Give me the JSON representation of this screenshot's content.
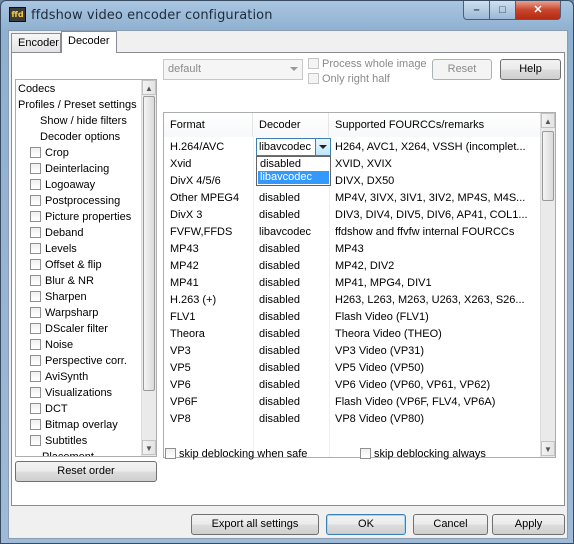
{
  "window": {
    "title": "ffdshow video encoder configuration",
    "icon": "ffdshow-app-icon",
    "icon_text": "ffd"
  },
  "caption_buttons": {
    "minimize": "–",
    "maximize": "□",
    "close": "✕"
  },
  "tabs": [
    {
      "label": "Encoder",
      "active": false
    },
    {
      "label": "Decoder",
      "active": true
    }
  ],
  "tree": {
    "items": [
      {
        "label": "Codecs",
        "indent": 0,
        "checkbox": false
      },
      {
        "label": "Profiles / Preset settings",
        "indent": 0,
        "checkbox": false
      },
      {
        "label": "Show / hide filters",
        "indent": 2,
        "checkbox": false
      },
      {
        "label": "Decoder options",
        "indent": 2,
        "checkbox": false
      },
      {
        "label": "Crop",
        "indent": 1,
        "checkbox": true
      },
      {
        "label": "Deinterlacing",
        "indent": 1,
        "checkbox": true
      },
      {
        "label": "Logoaway",
        "indent": 1,
        "checkbox": true
      },
      {
        "label": "Postprocessing",
        "indent": 1,
        "checkbox": true
      },
      {
        "label": "Picture properties",
        "indent": 1,
        "checkbox": true
      },
      {
        "label": "Deband",
        "indent": 1,
        "checkbox": true
      },
      {
        "label": "Levels",
        "indent": 1,
        "checkbox": true
      },
      {
        "label": "Offset & flip",
        "indent": 1,
        "checkbox": true
      },
      {
        "label": "Blur & NR",
        "indent": 1,
        "checkbox": true
      },
      {
        "label": "Sharpen",
        "indent": 1,
        "checkbox": true
      },
      {
        "label": "Warpsharp",
        "indent": 1,
        "checkbox": true
      },
      {
        "label": "DScaler filter",
        "indent": 1,
        "checkbox": true
      },
      {
        "label": "Noise",
        "indent": 1,
        "checkbox": true
      },
      {
        "label": "Perspective corr.",
        "indent": 1,
        "checkbox": true
      },
      {
        "label": "AviSynth",
        "indent": 1,
        "checkbox": true
      },
      {
        "label": "Visualizations",
        "indent": 1,
        "checkbox": true
      },
      {
        "label": "DCT",
        "indent": 1,
        "checkbox": true
      },
      {
        "label": "Bitmap overlay",
        "indent": 1,
        "checkbox": true
      },
      {
        "label": "Subtitles",
        "indent": 1,
        "checkbox": true
      },
      {
        "label": "Placement",
        "indent": 3,
        "checkbox": false
      }
    ]
  },
  "reset_order_label": "Reset order",
  "preset_combo": {
    "value": "default"
  },
  "process_whole_image": {
    "label": "Process whole image",
    "checked": false,
    "enabled": false
  },
  "only_right_half": {
    "label": "Only right half",
    "checked": false,
    "enabled": false
  },
  "reset_button": {
    "label": "Reset",
    "enabled": false
  },
  "help_button": {
    "label": "Help"
  },
  "grid": {
    "columns": [
      "Format",
      "Decoder",
      "Supported FOURCCs/remarks"
    ],
    "rows": [
      {
        "format": "H.264/AVC",
        "decoder": "libavcodec",
        "remarks": "H264, AVC1, X264, VSSH (incomplet..."
      },
      {
        "format": "Xvid",
        "decoder": "disabled",
        "remarks": "XVID, XVIX"
      },
      {
        "format": "DivX 4/5/6",
        "decoder": "disabled",
        "remarks": "DIVX, DX50"
      },
      {
        "format": "Other MPEG4",
        "decoder": "disabled",
        "remarks": "MP4V, 3IVX, 3IV1, 3IV2, MP4S, M4S..."
      },
      {
        "format": "DivX 3",
        "decoder": "disabled",
        "remarks": "DIV3, DIV4, DIV5, DIV6, AP41, COL1..."
      },
      {
        "format": "FVFW,FFDS",
        "decoder": "libavcodec",
        "remarks": "ffdshow and ffvfw internal FOURCCs"
      },
      {
        "format": "MP43",
        "decoder": "disabled",
        "remarks": "MP43"
      },
      {
        "format": "MP42",
        "decoder": "disabled",
        "remarks": "MP42, DIV2"
      },
      {
        "format": "MP41",
        "decoder": "disabled",
        "remarks": "MP41, MPG4, DIV1"
      },
      {
        "format": "H.263 (+)",
        "decoder": "disabled",
        "remarks": "H263, L263, M263, U263, X263, S26..."
      },
      {
        "format": "FLV1",
        "decoder": "disabled",
        "remarks": "Flash Video (FLV1)"
      },
      {
        "format": "Theora",
        "decoder": "disabled",
        "remarks": "Theora Video (THEO)"
      },
      {
        "format": "VP3",
        "decoder": "disabled",
        "remarks": "VP3 Video (VP31)"
      },
      {
        "format": "VP5",
        "decoder": "disabled",
        "remarks": "VP5 Video (VP50)"
      },
      {
        "format": "VP6",
        "decoder": "disabled",
        "remarks": "VP6 Video (VP60, VP61, VP62)"
      },
      {
        "format": "VP6F",
        "decoder": "disabled",
        "remarks": "Flash Video (VP6F, FLV4, VP6A)"
      },
      {
        "format": "VP8",
        "decoder": "disabled",
        "remarks": "VP8 Video (VP80)"
      }
    ],
    "open_dropdown": {
      "row": 0,
      "value": "libavcodec",
      "options": [
        "disabled",
        "libavcodec"
      ],
      "highlighted": "libavcodec"
    }
  },
  "skip_deblocking_safe": {
    "label": "skip deblocking when safe",
    "checked": false
  },
  "skip_deblocking_always": {
    "label": "skip deblocking always",
    "checked": false
  },
  "footer": {
    "export": "Export all settings",
    "ok": "OK",
    "cancel": "Cancel",
    "apply": "Apply"
  }
}
